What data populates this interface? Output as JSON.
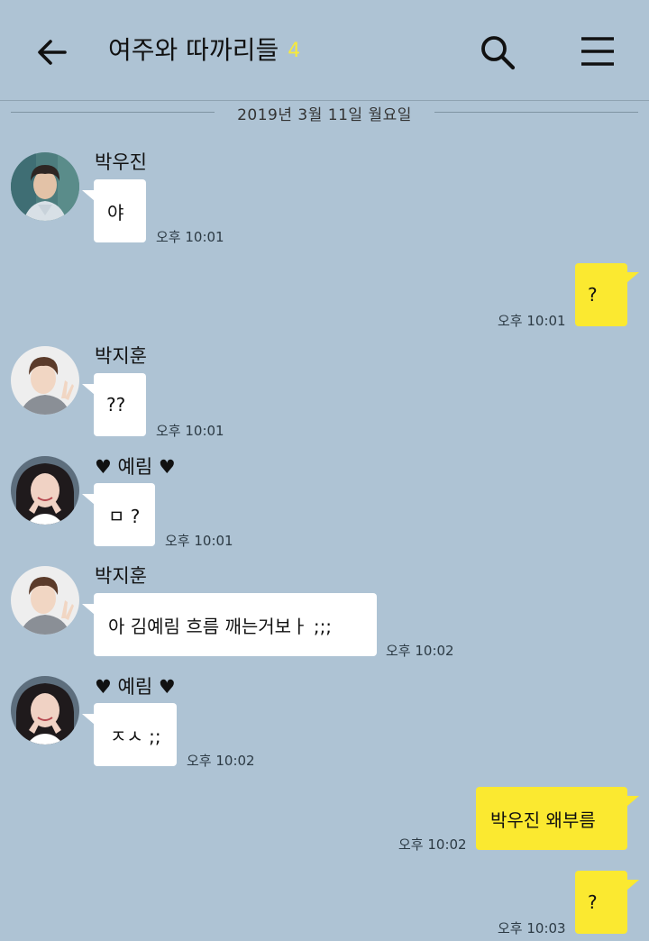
{
  "header": {
    "title": "여주와 따까리들",
    "member_count": "4"
  },
  "date_divider": "2019년 3월 11일 월요일",
  "colors": {
    "background": "#aec3d4",
    "incoming_bubble": "#ffffff",
    "outgoing_bubble": "#fbe930",
    "member_count": "#f7ea3b"
  },
  "messages": [
    {
      "sender": "박우진",
      "text": "야",
      "time": "오후 10:01",
      "direction": "in"
    },
    {
      "text": "?",
      "time": "오후 10:01",
      "direction": "out"
    },
    {
      "sender": "박지훈",
      "text": "??",
      "time": "오후 10:01",
      "direction": "in"
    },
    {
      "sender": "♥ 예림 ♥",
      "text": "ㅁ ?",
      "time": "오후 10:01",
      "direction": "in"
    },
    {
      "sender": "박지훈",
      "text": "아 김예림 흐름 깨는거보ㅏ ;;;",
      "time": "오후 10:02",
      "direction": "in"
    },
    {
      "sender": "♥ 예림 ♥",
      "text": "ㅈㅅ ;;",
      "time": "오후 10:02",
      "direction": "in"
    },
    {
      "text": "박우진 왜부름",
      "time": "오후 10:02",
      "direction": "out"
    },
    {
      "text": "?",
      "time": "오후 10:03",
      "direction": "out"
    }
  ]
}
